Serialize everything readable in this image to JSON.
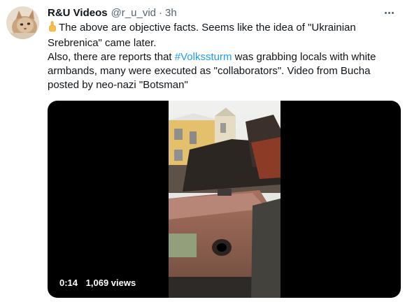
{
  "tweet": {
    "display_name": "R&U Videos",
    "handle": "@r_u_vid",
    "separator": "·",
    "time": "3h",
    "text_lines": [
      "The above are objective facts. Seems like the idea of \"Ukrainian",
      "Srebrenica\" came later.",
      "Also, there are reports that",
      "#Volkssturm",
      "was grabbing locals with white",
      "armbands, many were executed as \"collaborators\". Video from Bucha",
      "posted by neo-nazi \"Botsman\""
    ]
  },
  "video": {
    "duration": "0:14",
    "views": "1,069 views"
  },
  "icons": {
    "more": "more-horizontal-icon",
    "pointing": "pointing-up-emoji-icon"
  },
  "colors": {
    "text": "#0f1419",
    "secondary": "#536471",
    "link": "#1d9bf0",
    "media_bg": "#000000"
  }
}
